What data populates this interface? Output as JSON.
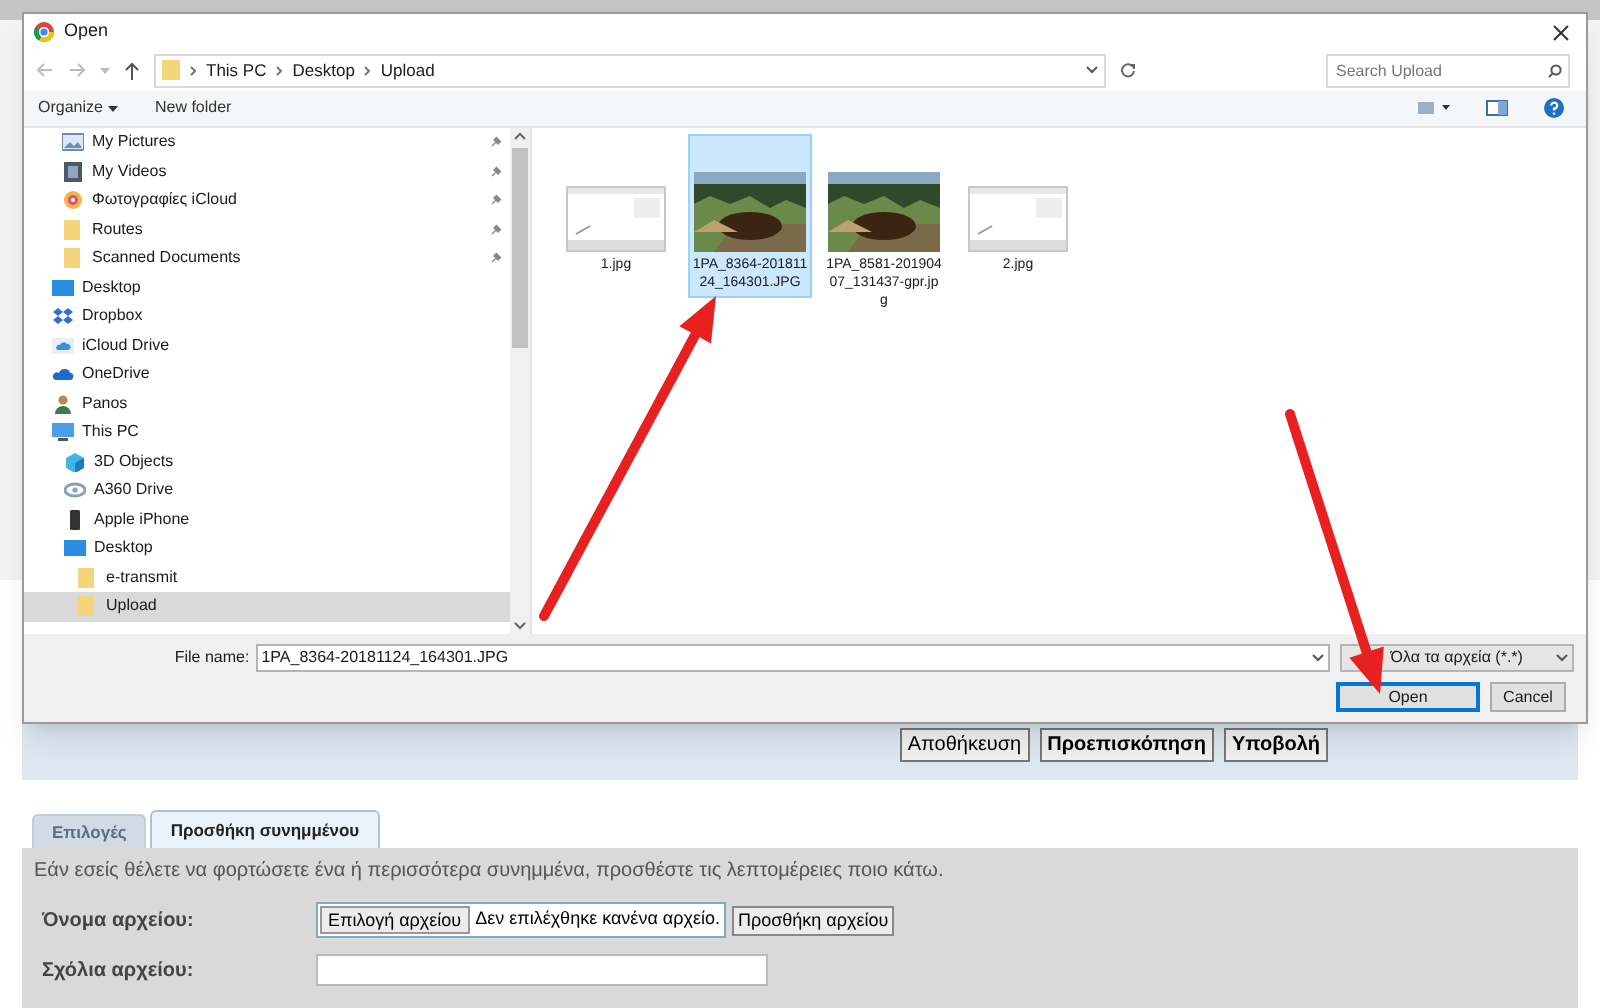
{
  "dialog": {
    "title": "Open",
    "breadcrumb": [
      "This PC",
      "Desktop",
      "Upload"
    ],
    "search": {
      "placeholder": "Search Upload"
    },
    "toolbar": {
      "organize": "Organize",
      "new_folder": "New folder"
    },
    "quick_access": [
      {
        "label": "My Pictures",
        "kind": "pictures",
        "pinned": true
      },
      {
        "label": "My Videos",
        "kind": "videos",
        "pinned": true
      },
      {
        "label": "Φωτογραφίες iCloud",
        "kind": "photos",
        "pinned": true
      },
      {
        "label": "Routes",
        "kind": "folder",
        "pinned": true
      },
      {
        "label": "Scanned Documents",
        "kind": "folder",
        "pinned": true
      }
    ],
    "tree": [
      {
        "label": "Desktop",
        "kind": "desktop",
        "selected": false
      },
      {
        "label": "Dropbox",
        "kind": "dropbox",
        "selected": false
      },
      {
        "label": "iCloud Drive",
        "kind": "cloud",
        "selected": false
      },
      {
        "label": "OneDrive",
        "kind": "onedrive",
        "selected": false
      },
      {
        "label": "Panos",
        "kind": "user",
        "selected": false
      },
      {
        "label": "This PC",
        "kind": "pc",
        "selected": false,
        "children": [
          {
            "label": "3D Objects",
            "kind": "cube",
            "selected": false
          },
          {
            "label": "A360 Drive",
            "kind": "drive",
            "selected": false
          },
          {
            "label": "Apple iPhone",
            "kind": "phone",
            "selected": false
          },
          {
            "label": "Desktop",
            "kind": "desktop",
            "selected": false,
            "children": [
              {
                "label": "e-transmit",
                "kind": "folder",
                "selected": false
              },
              {
                "label": "Upload",
                "kind": "folder",
                "selected": true
              }
            ]
          }
        ]
      }
    ],
    "files": [
      {
        "name": "1.jpg",
        "kind": "screenshot",
        "selected": false
      },
      {
        "name": "1PA_8364-20181124_164301.JPG",
        "kind": "picture",
        "selected": true
      },
      {
        "name": "1PA_8581-20190407_131437-gpr.jpg",
        "kind": "picture",
        "selected": false
      },
      {
        "name": "2.jpg",
        "kind": "screenshot",
        "selected": false
      }
    ],
    "file_name_label": "File name:",
    "file_name": "1PA_8364-20181124_164301.JPG",
    "file_type": "Όλα τα αρχεία (*.*)",
    "buttons": [
      {
        "label": "Open",
        "default": true
      },
      {
        "label": "Cancel",
        "default": false
      }
    ]
  },
  "page": {
    "actions": [
      {
        "label": "Αποθήκευση",
        "bold": false
      },
      {
        "label": "Προεπισκόπηση",
        "bold": true
      },
      {
        "label": "Υποβολή",
        "bold": true
      }
    ],
    "tabs": [
      {
        "label": "Επιλογές",
        "selected": false
      },
      {
        "label": "Προσθήκη συνημμένου",
        "selected": true
      }
    ],
    "intro": "Εάν εσείς θέλετε να φορτώσετε ένα ή περισσότερα συνημμένα, προσθέστε τις λεπτομέρειες ποιο κάτω.",
    "file_label": "Όνομα αρχείου:",
    "choose_button": "Επιλογή αρχείου",
    "no_file": "Δεν επιλέχθηκε κανένα αρχείο.",
    "add_button": "Προσθήκη αρχείου",
    "comments_label": "Σχόλια αρχείου:"
  }
}
